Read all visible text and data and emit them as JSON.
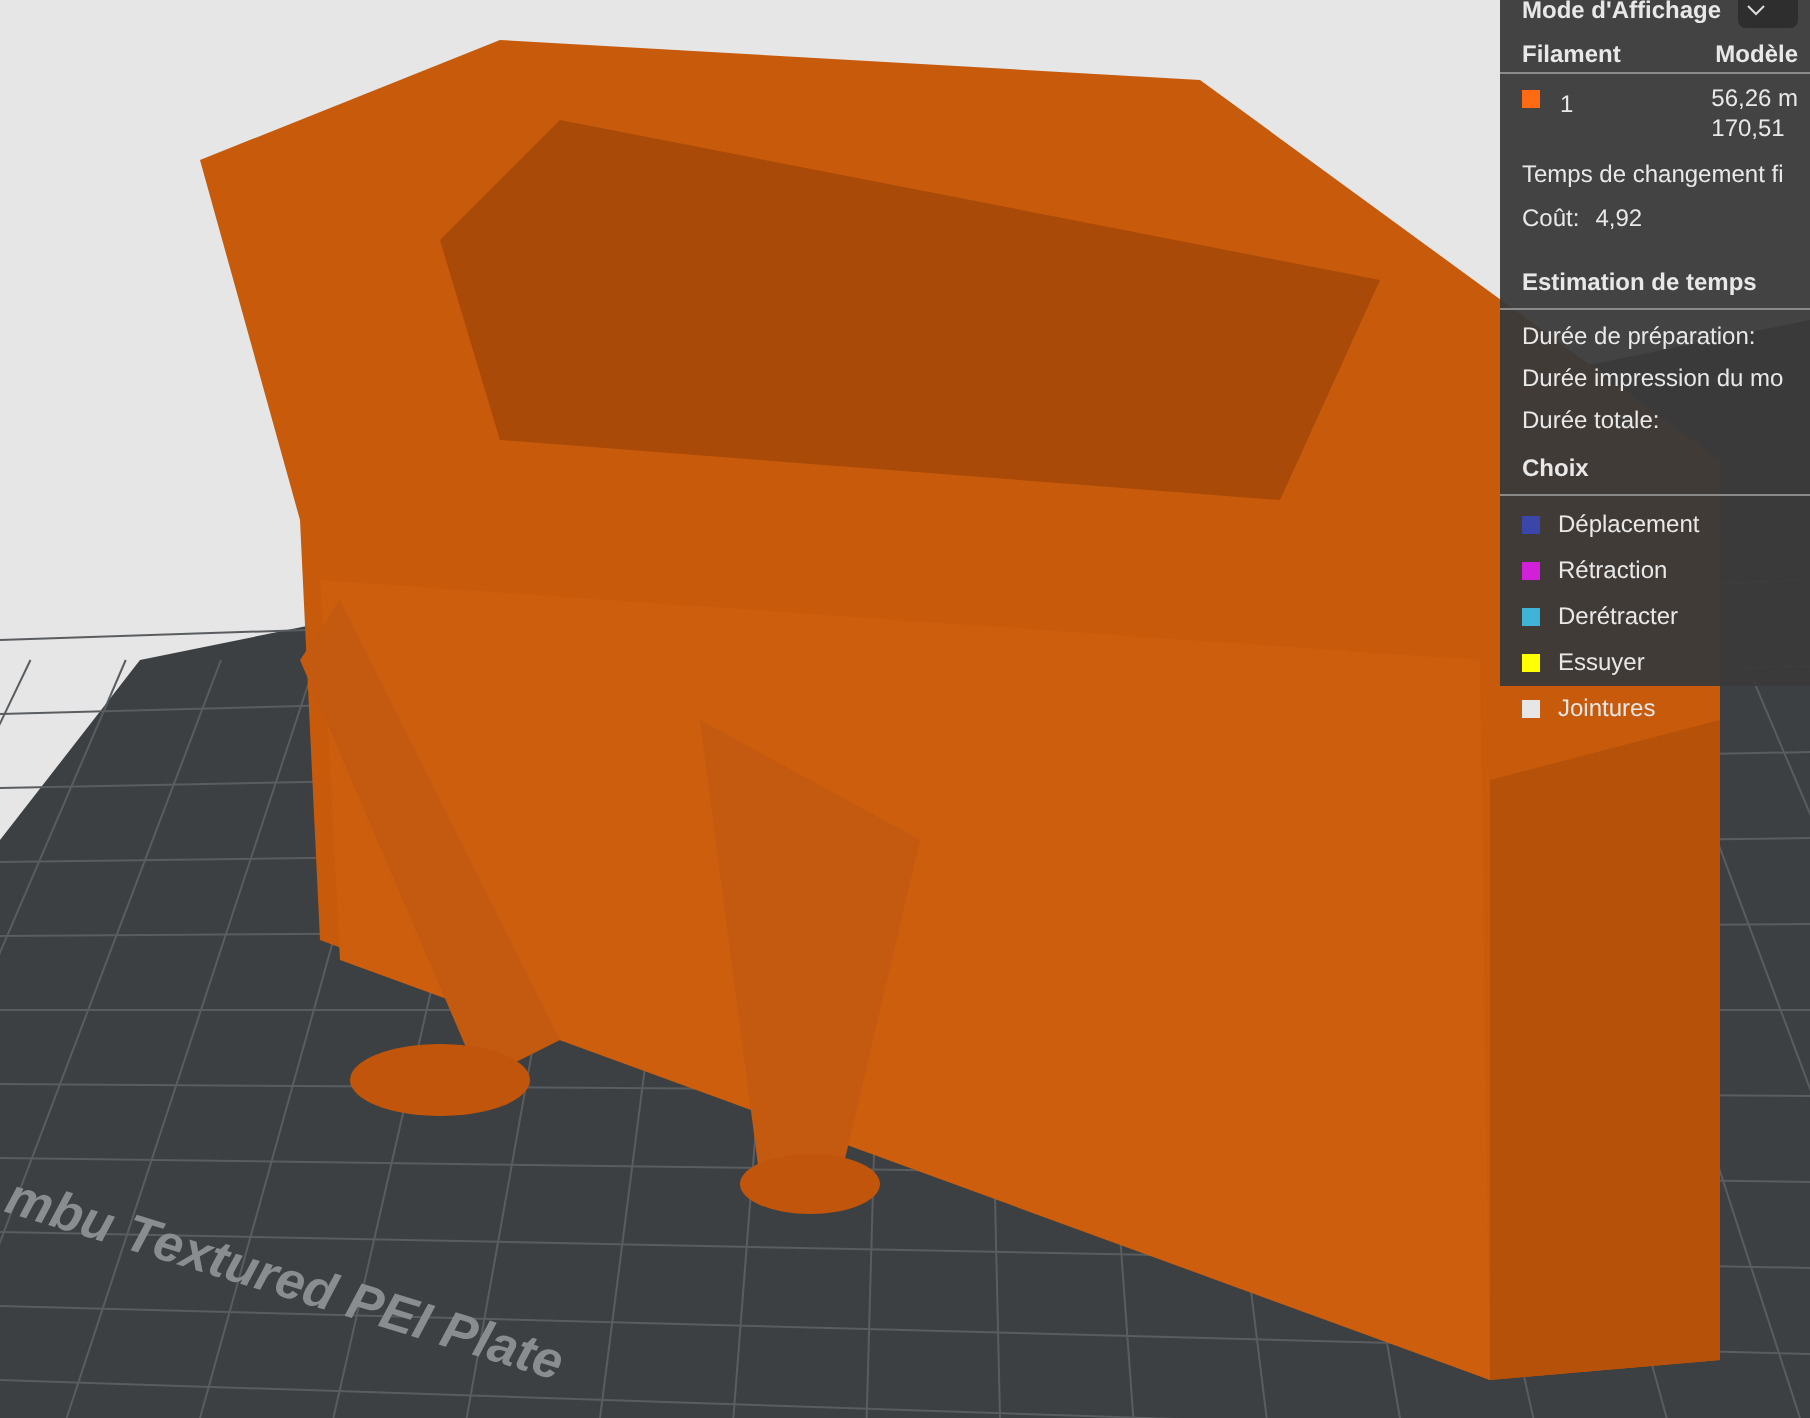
{
  "viewport": {
    "bed_label": "mbu Textured PEI Plate"
  },
  "panel": {
    "title": "Mode d'Affichage",
    "filament_header": [
      "Filament",
      "Modèle"
    ],
    "filaments": [
      {
        "name": "1",
        "color": "#ff6a13",
        "usage": [
          "56,26 m",
          "170,51"
        ]
      }
    ],
    "lines": [
      "Temps de changement fi"
    ],
    "cost": {
      "label": "Coût:",
      "value": "4,92"
    },
    "time_title": "Estimation de temps",
    "time_lines": [
      "Durée de préparation:",
      "Durée impression du mo",
      "Durée totale:"
    ],
    "legend_title": "Choix",
    "legend": [
      {
        "label": "Déplacement",
        "color": "#3a47a8"
      },
      {
        "label": "Rétraction",
        "color": "#d21fd8"
      },
      {
        "label": "Derétracter",
        "color": "#40b4d6"
      },
      {
        "label": "Essuyer",
        "color": "#ffff00"
      },
      {
        "label": "Jointures",
        "color": "#e6e6e6"
      }
    ]
  }
}
